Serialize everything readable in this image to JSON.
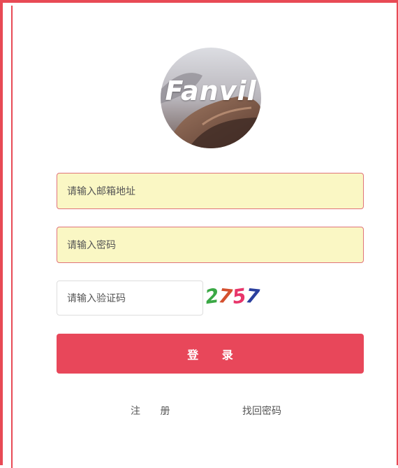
{
  "brand": {
    "logo_text": "Fanvil"
  },
  "form": {
    "email_placeholder": "请输入邮箱地址",
    "password_placeholder": "请输入密码",
    "captcha_placeholder": "请输入验证码",
    "captcha_code": [
      "2",
      "7",
      "5",
      "7"
    ],
    "captcha_colors": [
      "#3aa845",
      "#d4502e",
      "#e8356a",
      "#2a3f9e"
    ],
    "login_label": "登 录"
  },
  "links": {
    "register_label": "注 册",
    "recover_label": "找回密码"
  },
  "colors": {
    "accent": "#e8475a",
    "autofill_bg": "#faf7c4",
    "frame": "#e84a55"
  }
}
